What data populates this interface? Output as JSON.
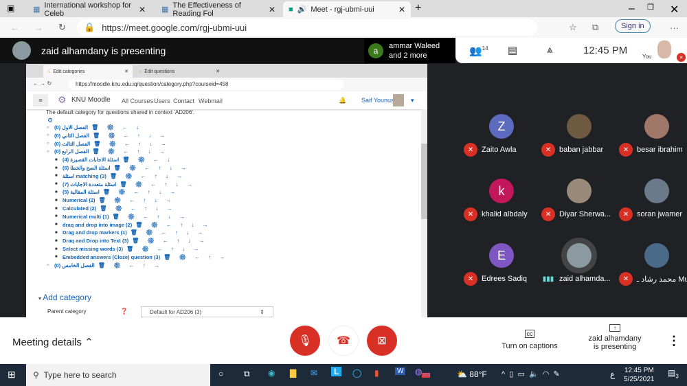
{
  "browser": {
    "tabs": [
      {
        "label": "International workshop for Celeb"
      },
      {
        "label": "The Effectiveness of Reading Fol"
      },
      {
        "label": "Meet - rgj-ubmi-uui"
      }
    ],
    "url": "https://meet.google.com/rgj-ubmi-uui",
    "sign_in": "Sign in"
  },
  "meet": {
    "presenting": "zaid alhamdany is presenting",
    "speaker": {
      "initial": "a",
      "line1": "ammar Waleed",
      "line2": "and 2 more"
    },
    "people_count": "14",
    "time": "12:45 PM",
    "you": "You"
  },
  "shared": {
    "tabs": [
      "Edit categories",
      "Edit questions"
    ],
    "url": "https://moodle.knu.edu.iq/question/category.php?courseid=458",
    "brand": "KNU Moodle",
    "nav": [
      "All Courses",
      "Users",
      "Contact",
      "Webmail"
    ],
    "user": "Saif Younus",
    "desc": "The default category for questions shared in context 'AD206'.",
    "categories": [
      {
        "label": "الفصل الاول (0)",
        "level": 0,
        "icons": "🗑 ⚙ ←   ↓"
      },
      {
        "label": "الفصل الثاني (0)",
        "level": 0,
        "icons": "🗑 ⚙ ← ↑ ↓ →"
      },
      {
        "label": "الفصل الثالث (0)",
        "level": 0,
        "icons": "🗑 ⚙ ← ↑ ↓ →"
      },
      {
        "label": "الفصل الرابع (0)",
        "level": 0,
        "icons": "🗑 ⚙ ← ↑ ↓ →"
      },
      {
        "label": "اسئلة الاجابات القصيرة (4)",
        "level": 1,
        "icons": "🗑 ⚙ ←   ↓"
      },
      {
        "label": "اسئلة الصح والخطا (6)",
        "level": 1,
        "icons": "🗑 ⚙ ← ↑ ↓ →"
      },
      {
        "label": "اسئلة matching (3)",
        "level": 1,
        "icons": "🗑 ⚙ ← ↑ ↓ →"
      },
      {
        "label": "اسئلة متعددة الاجابات (7)",
        "level": 1,
        "icons": "🗑 ⚙ ← ↑ ↓ →"
      },
      {
        "label": "اسئلة المقالية (5)",
        "level": 1,
        "icons": "🗑 ⚙ ← ↑ ↓ →"
      },
      {
        "label": "Numerical (2)",
        "level": 1,
        "icons": "🗑 ⚙ ← ↑ ↓ →"
      },
      {
        "label": "Calculated (2)",
        "level": 1,
        "icons": "🗑 ⚙ ← ↑ ↓ →"
      },
      {
        "label": "Numerical multi (1)",
        "level": 1,
        "icons": "🗑 ⚙ ← ↑ ↓ →"
      },
      {
        "label": "draq and drop into image (2)",
        "level": 1,
        "icons": "🗑 ⚙ ← ↑ ↓ →"
      },
      {
        "label": "Drag and drop markers (1)",
        "level": 1,
        "icons": "🗑 ⚙ ← ↑ ↓ →"
      },
      {
        "label": "Draq and Drop into Text (3)",
        "level": 1,
        "icons": "🗑 ⚙ ← ↑ ↓ →"
      },
      {
        "label": "Select missing words (3)",
        "level": 1,
        "icons": "🗑 ⚙ ← ↑ ↓ →"
      },
      {
        "label": "Embedded answers (Cloze) question (3)",
        "level": 1,
        "icons": "🗑 ⚙ ← ↑   →"
      },
      {
        "label": "الفصل الخامس (0)",
        "level": 0,
        "icons": "🗑 ⚙ ← ↑   →"
      }
    ],
    "add_category": "Add category",
    "parent_label": "Parent category",
    "parent_value": "Default for AD206 (3)"
  },
  "participants": [
    {
      "name": "Zaito Awla",
      "initial": "Z",
      "color": "#5c6bc0"
    },
    {
      "name": "baban jabbar",
      "initial": "",
      "color": "#6d5a40"
    },
    {
      "name": "besar ibrahim",
      "initial": "",
      "color": "#a0786a"
    },
    {
      "name": "khalid albdaly",
      "initial": "k",
      "color": "#c2185b"
    },
    {
      "name": "Diyar Sherwa...",
      "initial": "",
      "color": "#9a8a7a"
    },
    {
      "name": "soran jwamer",
      "initial": "",
      "color": "#6a7a8a"
    },
    {
      "name": "Edrees Sadiq",
      "initial": "E",
      "color": "#7e57c2"
    },
    {
      "name": "zaid alhamda...",
      "initial": "",
      "color": "#8a9aa0"
    },
    {
      "name": "محمد رشاد ـ Mu...",
      "initial": "",
      "color": "#4a6a8a"
    }
  ],
  "bottom": {
    "meeting_details": "Meeting details",
    "captions": "Turn on captions",
    "presenting_line1": "zaid alhamdany",
    "presenting_line2": "is presenting"
  },
  "taskbar": {
    "search": "Type here to search",
    "weather": "88°F",
    "time": "12:45 PM",
    "date": "5/25/2021",
    "badge": "323",
    "notif": "3",
    "lang": "ع"
  }
}
